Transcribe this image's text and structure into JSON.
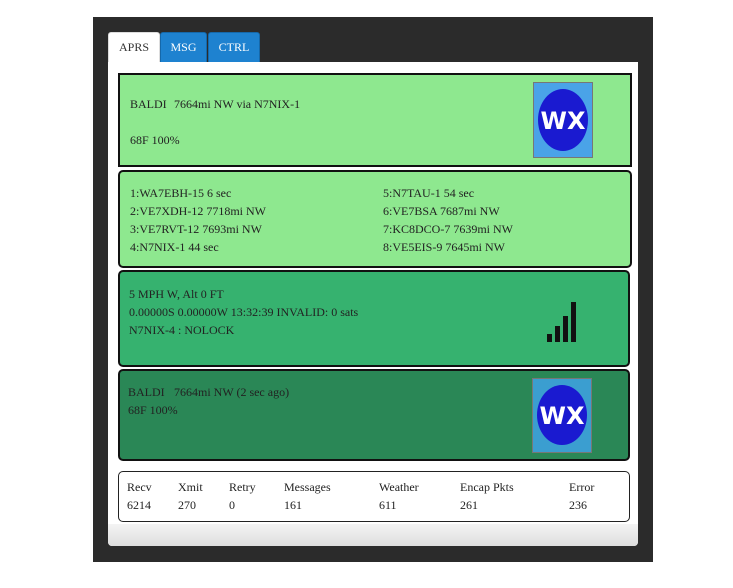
{
  "tabs": [
    "APRS",
    "MSG",
    "CTRL"
  ],
  "status": {
    "station": "BALDI",
    "location": "7664mi NW via N7NIX-1",
    "weather": "68F 100%",
    "icon": "wx-icon"
  },
  "heard": {
    "left": [
      "1:WA7EBH-15 6 sec",
      "2:VE7XDH-12 7718mi NW",
      "3:VE7RVT-12 7693mi NW",
      "4:N7NIX-1 44 sec"
    ],
    "right": [
      "5:N7TAU-1 54 sec",
      "6:VE7BSA 7687mi NW",
      "7:KC8DCO-7 7639mi NW",
      "8:VE5EIS-9 7645mi NW"
    ]
  },
  "gps": {
    "line1": "5 MPH W, Alt 0 FT",
    "line2": "0.00000S 0.00000W 13:32:39 INVALID: 0 sats",
    "line3": "N7NIX-4 : NOLOCK",
    "icon": "signal-bars-icon"
  },
  "last": {
    "station": "BALDI",
    "location": "7664mi NW (2 sec ago)",
    "weather": "68F 100%",
    "icon": "wx-icon"
  },
  "stats": [
    {
      "label": "Recv",
      "value": "6214"
    },
    {
      "label": "Xmit",
      "value": "270"
    },
    {
      "label": "Retry",
      "value": "0"
    },
    {
      "label": "Messages",
      "value": "161"
    },
    {
      "label": "Weather",
      "value": "611"
    },
    {
      "label": "Encap Pkts",
      "value": "261"
    },
    {
      "label": "Error",
      "value": "236"
    }
  ],
  "colors": {
    "tab_blue": "#1e82d0",
    "box_light": "#8ee88f",
    "box_mid": "#36b26f",
    "box_dark": "#2a8756",
    "frame": "#2b2b2b"
  }
}
